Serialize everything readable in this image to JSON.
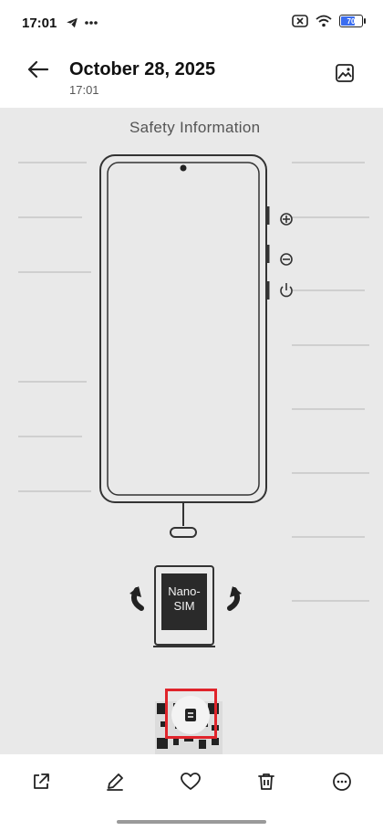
{
  "status_bar": {
    "time": "17:01",
    "left_icons": [
      "telegram-icon",
      "more-dots-icon"
    ],
    "right_icons": [
      "signal-blocked-icon",
      "wifi-icon",
      "battery-icon"
    ],
    "battery_level": "70",
    "battery_fraction": 0.7,
    "battery_color": "#3b6df0"
  },
  "header": {
    "title": "October 28, 2025",
    "subtitle": "17:01",
    "back_icon": "arrow-left-icon",
    "right_icon": "image-icon"
  },
  "photo": {
    "caption": "Safety Information",
    "sim_label_line1": "Nano-",
    "sim_label_line2": "SIM"
  },
  "overlay": {
    "icon": "document-icon",
    "highlight_color": "#e0242b"
  },
  "toolbar": {
    "items": [
      "share-icon",
      "edit-pencil-icon",
      "favorite-heart-icon",
      "delete-trash-icon",
      "more-icon"
    ]
  }
}
